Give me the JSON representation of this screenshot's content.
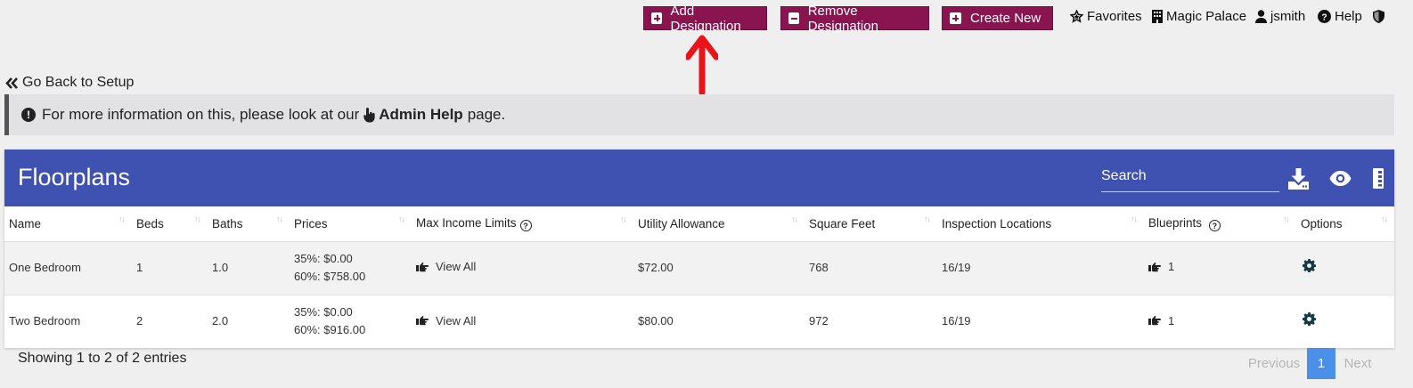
{
  "topbar": {
    "add_designation": "Add Designation",
    "remove_designation": "Remove Designation",
    "create_new": "Create New",
    "favorites": "Favorites",
    "property": "Magic Palace",
    "user": "jsmith",
    "help": "Help"
  },
  "go_back": "Go Back to Setup",
  "info": {
    "prefix": "For more information on this, please look at our",
    "link": "Admin Help",
    "suffix": "page."
  },
  "panel": {
    "title": "Floorplans",
    "search_placeholder": "Search"
  },
  "table": {
    "headers": [
      "Name",
      "Beds",
      "Baths",
      "Prices",
      "Max Income Limits",
      "Utility Allowance",
      "Square Feet",
      "Inspection Locations",
      "Blueprints",
      "Options"
    ],
    "rows": [
      {
        "name": "One Bedroom",
        "beds": "1",
        "baths": "1.0",
        "price1": "35%: $0.00",
        "price2": "60%: $758.00",
        "income": "View All",
        "utility": "$72.00",
        "sqft": "768",
        "inspection": "16/19",
        "blueprints": "1"
      },
      {
        "name": "Two Bedroom",
        "beds": "2",
        "baths": "2.0",
        "price1": "35%: $0.00",
        "price2": "60%: $916.00",
        "income": "View All",
        "utility": "$80.00",
        "sqft": "972",
        "inspection": "16/19",
        "blueprints": "1"
      }
    ]
  },
  "footer": {
    "showing": "Showing 1 to 2 of 2 entries",
    "previous": "Previous",
    "page": "1",
    "next": "Next"
  },
  "colors": {
    "maroon": "#8a1450",
    "panel_header": "#3f51b1",
    "pager_active": "#4a90e8",
    "annotation": "#e8141a"
  }
}
